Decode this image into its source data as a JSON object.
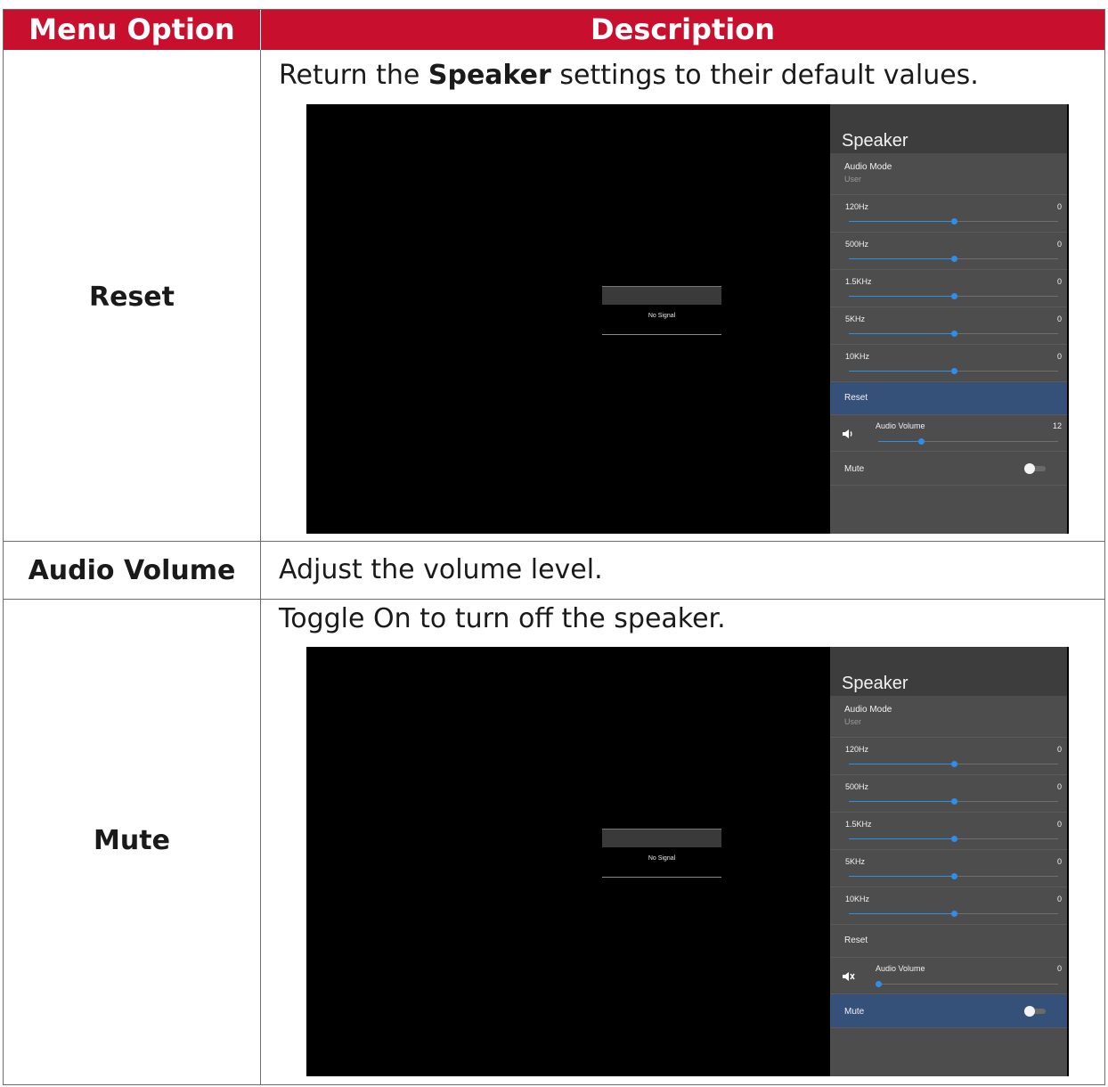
{
  "header": {
    "col1": "Menu Option",
    "col2": "Description"
  },
  "rows": [
    {
      "option": "Reset",
      "desc_pre": "Return the ",
      "desc_bold": "Speaker",
      "desc_post": " settings to their default values."
    },
    {
      "option": "Audio Volume",
      "desc": "Adjust the volume level."
    },
    {
      "option": "Mute",
      "desc": "Toggle On to turn off the speaker."
    }
  ],
  "screens": [
    {
      "no_signal": "No Signal",
      "panel_title": "Speaker",
      "audio_mode_label": "Audio Mode",
      "audio_mode_value": "User",
      "eq": [
        {
          "label": "120Hz",
          "value": "0",
          "level": 0.5
        },
        {
          "label": "500Hz",
          "value": "0",
          "level": 0.5
        },
        {
          "label": "1.5KHz",
          "value": "0",
          "level": 0.5
        },
        {
          "label": "5KHz",
          "value": "0",
          "level": 0.5
        },
        {
          "label": "10KHz",
          "value": "0",
          "level": 0.5
        }
      ],
      "reset_label": "Reset",
      "volume_label": "Audio Volume",
      "volume_value": "12",
      "volume_level": 0.24,
      "mute_label": "Mute",
      "selected": "Reset",
      "speaker_icon": "speaker-icon"
    },
    {
      "no_signal": "No Signal",
      "panel_title": "Speaker",
      "audio_mode_label": "Audio Mode",
      "audio_mode_value": "User",
      "eq": [
        {
          "label": "120Hz",
          "value": "0",
          "level": 0.5
        },
        {
          "label": "500Hz",
          "value": "0",
          "level": 0.5
        },
        {
          "label": "1.5KHz",
          "value": "0",
          "level": 0.5
        },
        {
          "label": "5KHz",
          "value": "0",
          "level": 0.5
        },
        {
          "label": "10KHz",
          "value": "0",
          "level": 0.5
        }
      ],
      "reset_label": "Reset",
      "volume_label": "Audio Volume",
      "volume_value": "0",
      "volume_level": 0,
      "mute_label": "Mute",
      "selected": "Mute",
      "speaker_icon": "speaker-muted-icon"
    }
  ],
  "colors": {
    "header_bg": "#c8102e",
    "accent": "#2f8fe8",
    "selected_bg": "#355079"
  }
}
